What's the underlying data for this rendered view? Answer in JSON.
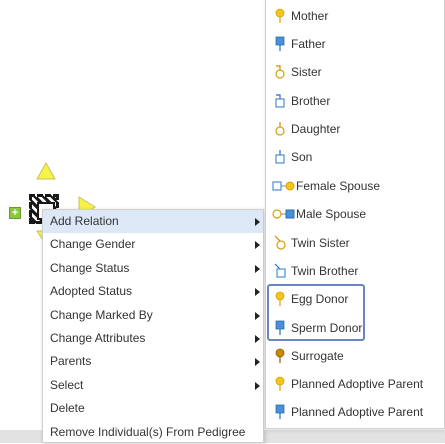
{
  "context_menu": {
    "items": [
      {
        "label": "Add Relation",
        "has_submenu": true,
        "active": true
      },
      {
        "label": "Change Gender",
        "has_submenu": true
      },
      {
        "label": "Change Status",
        "has_submenu": true
      },
      {
        "label": "Adopted Status",
        "has_submenu": true
      },
      {
        "label": "Change Marked By",
        "has_submenu": true
      },
      {
        "label": "Change Attributes",
        "has_submenu": true
      },
      {
        "label": "Parents",
        "has_submenu": true
      },
      {
        "label": "Select",
        "has_submenu": true
      },
      {
        "label": "Delete",
        "has_submenu": false
      },
      {
        "label": "Remove Individual(s) From Pedigree",
        "has_submenu": false
      }
    ]
  },
  "submenu": {
    "items": [
      {
        "label": "Mother",
        "icon": "female-yellow-icon"
      },
      {
        "label": "Father",
        "icon": "male-blue-icon"
      },
      {
        "label": "Sister",
        "icon": "sister-icon"
      },
      {
        "label": "Brother",
        "icon": "brother-icon"
      },
      {
        "label": "Daughter",
        "icon": "daughter-icon"
      },
      {
        "label": "Son",
        "icon": "son-icon"
      },
      {
        "label": "Female Spouse",
        "icon": "female-spouse-icon"
      },
      {
        "label": "Male Spouse",
        "icon": "male-spouse-icon"
      },
      {
        "label": "Twin Sister",
        "icon": "twin-sister-icon"
      },
      {
        "label": "Twin Brother",
        "icon": "twin-brother-icon"
      },
      {
        "label": "Egg Donor",
        "icon": "egg-donor-icon",
        "highlighted": true
      },
      {
        "label": "Sperm Donor",
        "icon": "sperm-donor-icon",
        "highlighted": true
      },
      {
        "label": "Surrogate",
        "icon": "surrogate-icon"
      },
      {
        "label": "Planned Adoptive Parent",
        "icon": "planned-adoptive-female-icon"
      },
      {
        "label": "Planned Adoptive Parent",
        "icon": "planned-adoptive-male-icon"
      }
    ]
  },
  "canvas": {
    "add_button_label": "+"
  },
  "colors": {
    "female": "#f5c518",
    "male": "#4a90d9",
    "highlight_border": "#6a86c2",
    "active_item_bg": "#dce8f5",
    "individual_triangle": "#f7f24a"
  }
}
